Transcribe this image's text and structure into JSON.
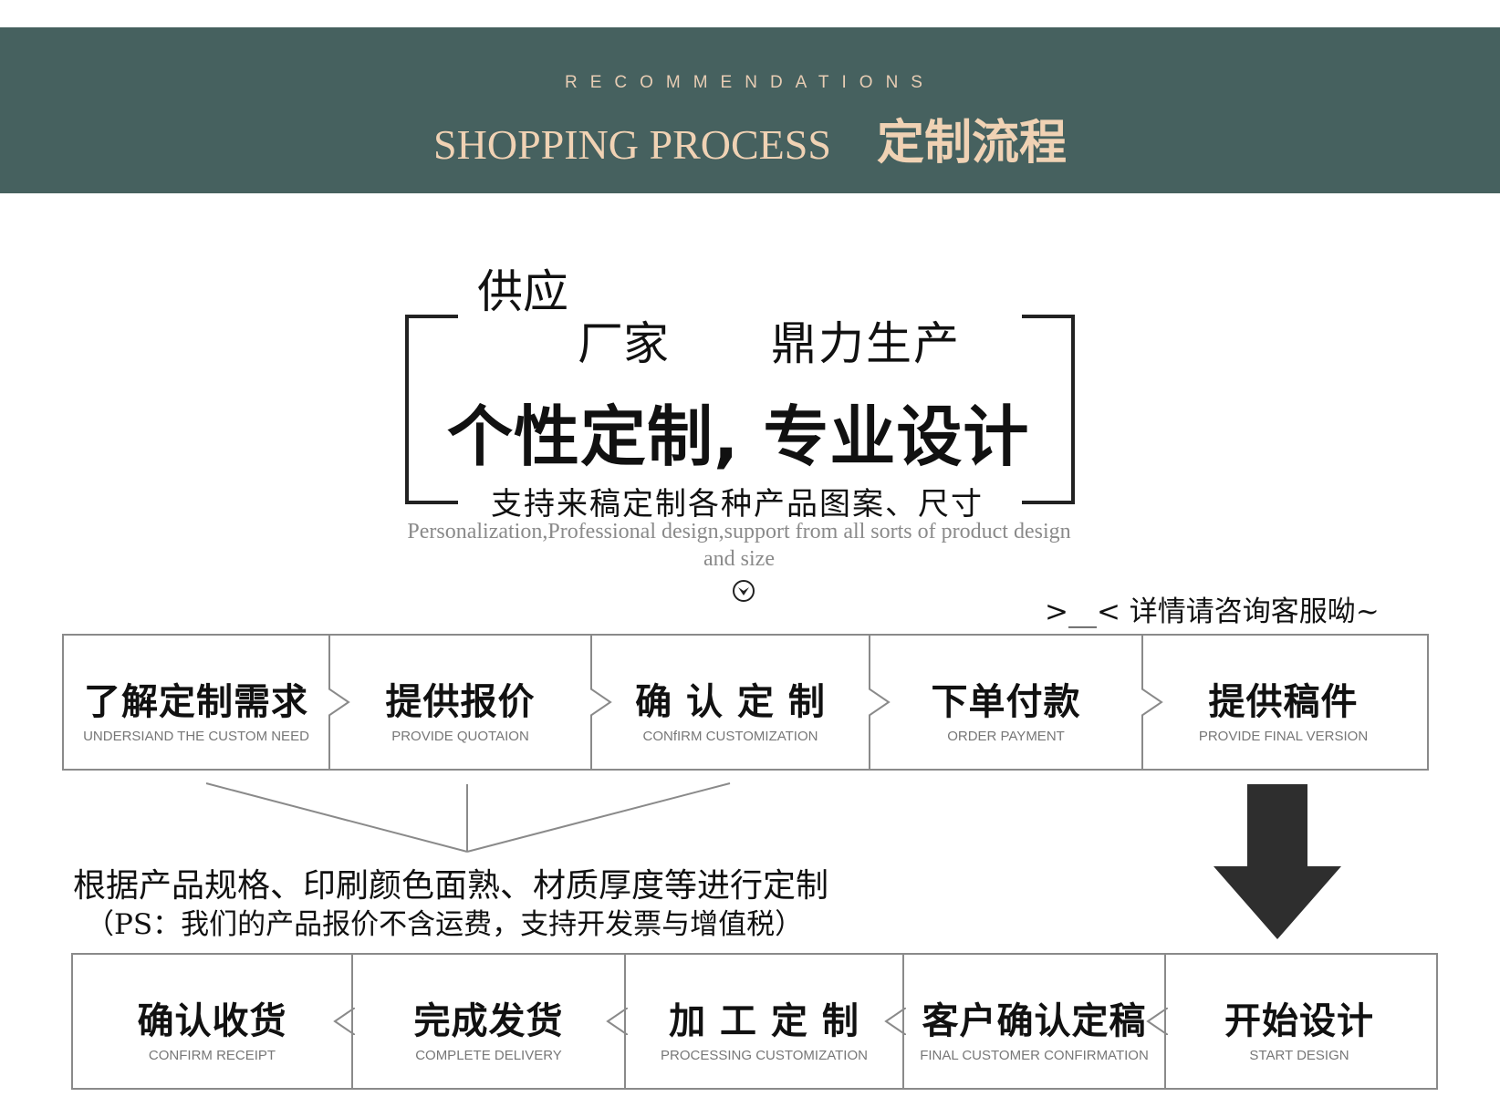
{
  "header": {
    "eyebrow": "RECOMMENDATIONS",
    "title_en": "SHOPPING PROCESS",
    "title_cn": "定制流程",
    "background": "#46615f",
    "text_color": "#f0d2b4"
  },
  "intro": {
    "supply_a": "供应",
    "supply_b": "厂家",
    "supply_c": "鼎力生产",
    "headline": "个性定制, 专业设计",
    "support_cn": "支持来稿定制各种产品图案、尺寸",
    "support_en": "Personalization,Professional design,support from all sorts of product design and size",
    "consult": ">__< 详情请咨询客服呦~"
  },
  "steps_top": [
    {
      "cn": "了解定制需求",
      "en": "UNDERSIAND THE CUSTOM NEED"
    },
    {
      "cn": "提供报价",
      "en": "PROVIDE QUOTAION"
    },
    {
      "cn": "确 认 定 制",
      "en": "CONfIRM CUSTOMIZATION"
    },
    {
      "cn": "下单付款",
      "en": "ORDER PAYMENT"
    },
    {
      "cn": "提供稿件",
      "en": "PROVIDE FINAL VERSION"
    }
  ],
  "notes": {
    "custom": "根据产品规格、印刷颜色面熟、材质厚度等进行定制",
    "ps": "（PS：我们的产品报价不含运费，支持开发票与增值税）"
  },
  "steps_bottom": [
    {
      "cn": "确认收货",
      "en": "CONFIRM RECEIPT"
    },
    {
      "cn": "完成发货",
      "en": "COMPLETE DELIVERY"
    },
    {
      "cn": "加 工 定 制",
      "en": "PROCESSING CUSTOMIZATION"
    },
    {
      "cn": "客户确认定稿",
      "en": "FINAL CUSTOMER CONFIRMATION"
    },
    {
      "cn": "开始设计",
      "en": "START DESIGN"
    }
  ],
  "colors": {
    "border": "#8a8a8a",
    "arrow": "#2e2e2e"
  }
}
